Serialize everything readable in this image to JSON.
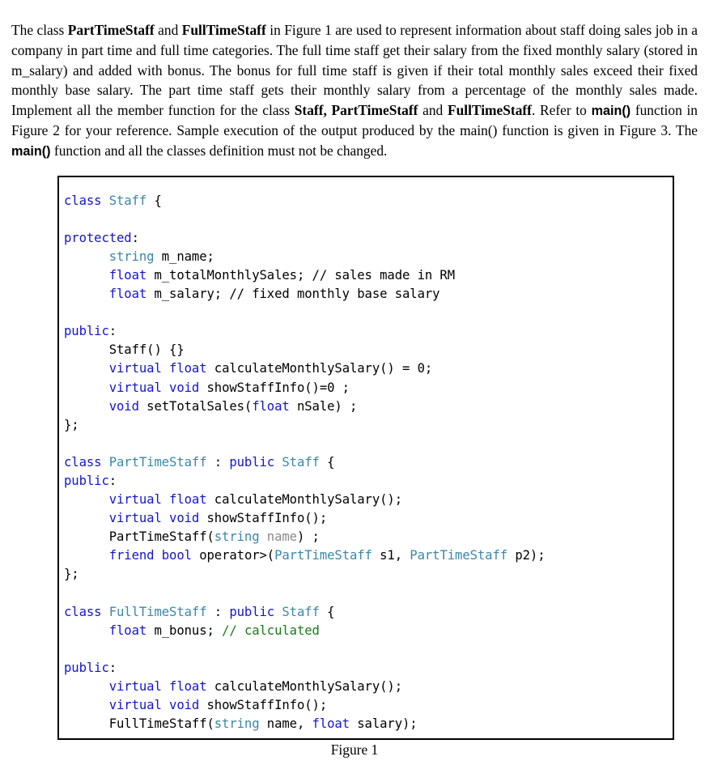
{
  "document": {
    "intro": {
      "segments": [
        {
          "text": "The class ",
          "style": "normal"
        },
        {
          "text": "PartTimeStaff",
          "style": "bold"
        },
        {
          "text": " and ",
          "style": "normal"
        },
        {
          "text": "FullTimeStaff",
          "style": "bold"
        },
        {
          "text": " in Figure 1 are used to represent information about staff doing sales job in a company in part time and full time categories. The full time staff get their salary from the fixed monthly salary (stored in m_salary) and added with bonus. The bonus for full time staff is given if their total monthly sales exceed their fixed monthly base salary. The part time staff gets their monthly salary from a percentage of the monthly sales made.  Implement all the member function for the class ",
          "style": "normal"
        },
        {
          "text": "Staff, PartTimeStaff",
          "style": "bold"
        },
        {
          "text": " and ",
          "style": "normal"
        },
        {
          "text": "FullTimeStaff",
          "style": "bold"
        },
        {
          "text": ".  Refer to ",
          "style": "normal"
        },
        {
          "text": "main()",
          "style": "bold-sans"
        },
        {
          "text": " function in Figure 2 for your reference. Sample execution of the output produced by the main() function is given in Figure 3. The ",
          "style": "normal"
        },
        {
          "text": "main()",
          "style": "bold-sans"
        },
        {
          "text": " function and all the classes definition must not be changed.",
          "style": "normal"
        }
      ],
      "plain_text": "The class PartTimeStaff and FullTimeStaff in Figure 1 are used to represent information about staff doing sales job in a company in part time and full time categories. The full time staff get their salary from the fixed monthly salary (stored in m_salary) and added with bonus. The bonus for full time staff is given if their total monthly sales exceed their fixed monthly base salary. The part time staff gets their monthly salary from a percentage of the monthly sales made.  Implement all the member function for the class Staff, PartTimeStaff and FullTimeStaff.  Refer to main() function in Figure 2 for your reference. Sample execution of the output produced by the main() function is given in Figure 3. The main() function and all the classes definition must not be changed."
    },
    "code_figure": {
      "language": "cpp",
      "lines": [
        [
          {
            "t": "class ",
            "c": "kw"
          },
          {
            "t": "Staff ",
            "c": "typ"
          },
          {
            "t": "{",
            "c": "pln"
          }
        ],
        [],
        [
          {
            "t": "protected",
            "c": "kw"
          },
          {
            "t": ":",
            "c": "pln"
          }
        ],
        [
          {
            "t": "      ",
            "c": "pln"
          },
          {
            "t": "string",
            "c": "typ"
          },
          {
            "t": " m_name;",
            "c": "pln"
          }
        ],
        [
          {
            "t": "      ",
            "c": "pln"
          },
          {
            "t": "float",
            "c": "kw"
          },
          {
            "t": " m_totalMonthlySales; ",
            "c": "pln"
          },
          {
            "t": "// sales made in RM",
            "c": "cmt"
          }
        ],
        [
          {
            "t": "      ",
            "c": "pln"
          },
          {
            "t": "float",
            "c": "kw"
          },
          {
            "t": " m_salary; ",
            "c": "pln"
          },
          {
            "t": "// fixed monthly base salary",
            "c": "cmt"
          }
        ],
        [],
        [
          {
            "t": "public",
            "c": "kw"
          },
          {
            "t": ":",
            "c": "pln"
          }
        ],
        [
          {
            "t": "      Staff() {}",
            "c": "pln"
          }
        ],
        [
          {
            "t": "      ",
            "c": "pln"
          },
          {
            "t": "virtual ",
            "c": "kw"
          },
          {
            "t": "float",
            "c": "kw"
          },
          {
            "t": " calculateMonthlySalary() = 0;",
            "c": "pln"
          }
        ],
        [
          {
            "t": "      ",
            "c": "pln"
          },
          {
            "t": "virtual ",
            "c": "kw"
          },
          {
            "t": "void",
            "c": "kw"
          },
          {
            "t": " showStaffInfo()=0 ;",
            "c": "pln"
          }
        ],
        [
          {
            "t": "      ",
            "c": "pln"
          },
          {
            "t": "void",
            "c": "kw"
          },
          {
            "t": " setTotalSales(",
            "c": "pln"
          },
          {
            "t": "float",
            "c": "kw"
          },
          {
            "t": " nSale) ;",
            "c": "pln"
          }
        ],
        [
          {
            "t": "};",
            "c": "pln"
          }
        ],
        [],
        [
          {
            "t": "class ",
            "c": "kw"
          },
          {
            "t": "PartTimeStaff ",
            "c": "typ"
          },
          {
            "t": ": ",
            "c": "pln"
          },
          {
            "t": "public ",
            "c": "kw"
          },
          {
            "t": "Staff ",
            "c": "typ"
          },
          {
            "t": "{",
            "c": "pln"
          }
        ],
        [
          {
            "t": "public",
            "c": "kw"
          },
          {
            "t": ":",
            "c": "pln"
          }
        ],
        [
          {
            "t": "      ",
            "c": "pln"
          },
          {
            "t": "virtual ",
            "c": "kw"
          },
          {
            "t": "float",
            "c": "kw"
          },
          {
            "t": " calculateMonthlySalary();",
            "c": "pln"
          }
        ],
        [
          {
            "t": "      ",
            "c": "pln"
          },
          {
            "t": "virtual ",
            "c": "kw"
          },
          {
            "t": "void",
            "c": "kw"
          },
          {
            "t": " showStaffInfo();",
            "c": "pln"
          }
        ],
        [
          {
            "t": "      PartTimeStaff(",
            "c": "pln"
          },
          {
            "t": "string",
            "c": "typ"
          },
          {
            "t": " ",
            "c": "pln"
          },
          {
            "t": "name",
            "c": "par"
          },
          {
            "t": ") ;",
            "c": "pln"
          }
        ],
        [
          {
            "t": "      ",
            "c": "pln"
          },
          {
            "t": "friend ",
            "c": "kw"
          },
          {
            "t": "bool",
            "c": "kw"
          },
          {
            "t": " operator>(",
            "c": "pln"
          },
          {
            "t": "PartTimeStaff",
            "c": "typ"
          },
          {
            "t": " s1, ",
            "c": "pln"
          },
          {
            "t": "PartTimeStaff",
            "c": "typ"
          },
          {
            "t": " p2);",
            "c": "pln"
          }
        ],
        [
          {
            "t": "};",
            "c": "pln"
          }
        ],
        [],
        [
          {
            "t": "class ",
            "c": "kw"
          },
          {
            "t": "FullTimeStaff ",
            "c": "typ"
          },
          {
            "t": ": ",
            "c": "pln"
          },
          {
            "t": "public ",
            "c": "kw"
          },
          {
            "t": "Staff ",
            "c": "typ"
          },
          {
            "t": "{",
            "c": "pln"
          }
        ],
        [
          {
            "t": "      ",
            "c": "pln"
          },
          {
            "t": "float",
            "c": "kw"
          },
          {
            "t": " m_bonus; ",
            "c": "pln"
          },
          {
            "t": "// calculated",
            "c": "cmtg"
          }
        ],
        [],
        [
          {
            "t": "public",
            "c": "kw"
          },
          {
            "t": ":",
            "c": "pln"
          }
        ],
        [
          {
            "t": "      ",
            "c": "pln"
          },
          {
            "t": "virtual ",
            "c": "kw"
          },
          {
            "t": "float",
            "c": "kw"
          },
          {
            "t": " calculateMonthlySalary();",
            "c": "pln"
          }
        ],
        [
          {
            "t": "      ",
            "c": "pln"
          },
          {
            "t": "virtual ",
            "c": "kw"
          },
          {
            "t": "void",
            "c": "kw"
          },
          {
            "t": " showStaffInfo();",
            "c": "pln"
          }
        ],
        [
          {
            "t": "      FullTimeStaff(",
            "c": "pln"
          },
          {
            "t": "string",
            "c": "typ"
          },
          {
            "t": " name, ",
            "c": "pln"
          },
          {
            "t": "float",
            "c": "kw"
          },
          {
            "t": " salary);",
            "c": "pln"
          }
        ],
        [],
        [
          {
            "t": "};",
            "c": "pln"
          }
        ]
      ],
      "plain_text": "class Staff {\n\nprotected:\n      string m_name;\n      float m_totalMonthlySales; // sales made in RM\n      float m_salary; // fixed monthly base salary\n\npublic:\n      Staff() {}\n      virtual float calculateMonthlySalary() = 0;\n      virtual void showStaffInfo()=0 ;\n      void setTotalSales(float nSale) ;\n};\n\nclass PartTimeStaff : public Staff {\npublic:\n      virtual float calculateMonthlySalary();\n      virtual void showStaffInfo();\n      PartTimeStaff(string name) ;\n      friend bool operator>(PartTimeStaff s1, PartTimeStaff p2);\n};\n\nclass FullTimeStaff : public Staff {\n      float m_bonus; // calculated\n\npublic:\n      virtual float calculateMonthlySalary();\n      virtual void showStaffInfo();\n      FullTimeStaff(string name, float salary);\n\n};"
    },
    "caption": "Figure 1",
    "colors": {
      "keyword": "#1414d2",
      "type": "#3b87a8",
      "comment_black": "#000000",
      "comment_green": "#1a7a1a",
      "param_dim": "#8a8a8a",
      "text": "#000000",
      "border": "#000000",
      "background": "#ffffff"
    }
  }
}
